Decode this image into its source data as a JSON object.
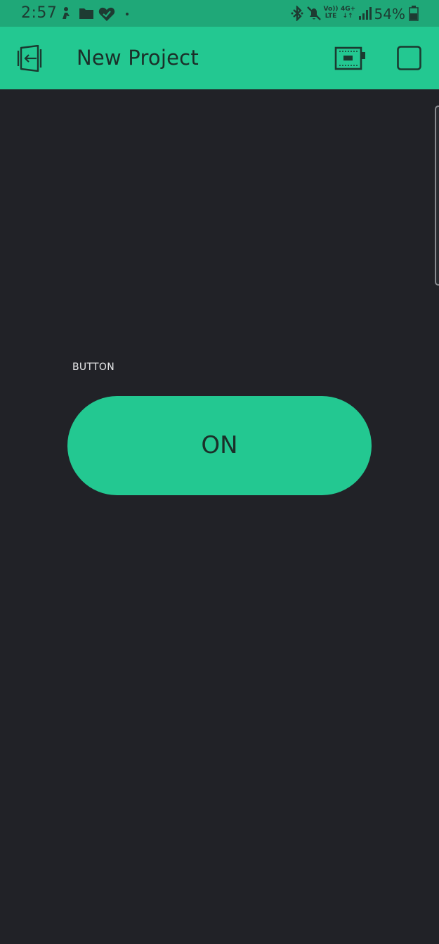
{
  "status_bar": {
    "time": "2:57",
    "volte_line1": "Vo))",
    "volte_line2": "LTE",
    "network_line1": "4G+",
    "network_line2": "↓↑",
    "battery_percent": "54%",
    "icons": [
      "person-icon",
      "folder-icon",
      "heart-check-icon",
      "dot-icon",
      "bluetooth-icon",
      "mute-icon",
      "signal-icon",
      "battery-icon"
    ]
  },
  "app_bar": {
    "title": "New Project",
    "icons": [
      "exit-icon",
      "device-icon",
      "play-square-icon"
    ]
  },
  "widget": {
    "label": "BUTTON",
    "button_text": "ON",
    "state": "on"
  },
  "colors": {
    "accent": "#23c891",
    "status_bar": "#1fa878",
    "background": "#212227",
    "text_dark": "#1b2f29",
    "label_text": "#e8e9ea"
  }
}
